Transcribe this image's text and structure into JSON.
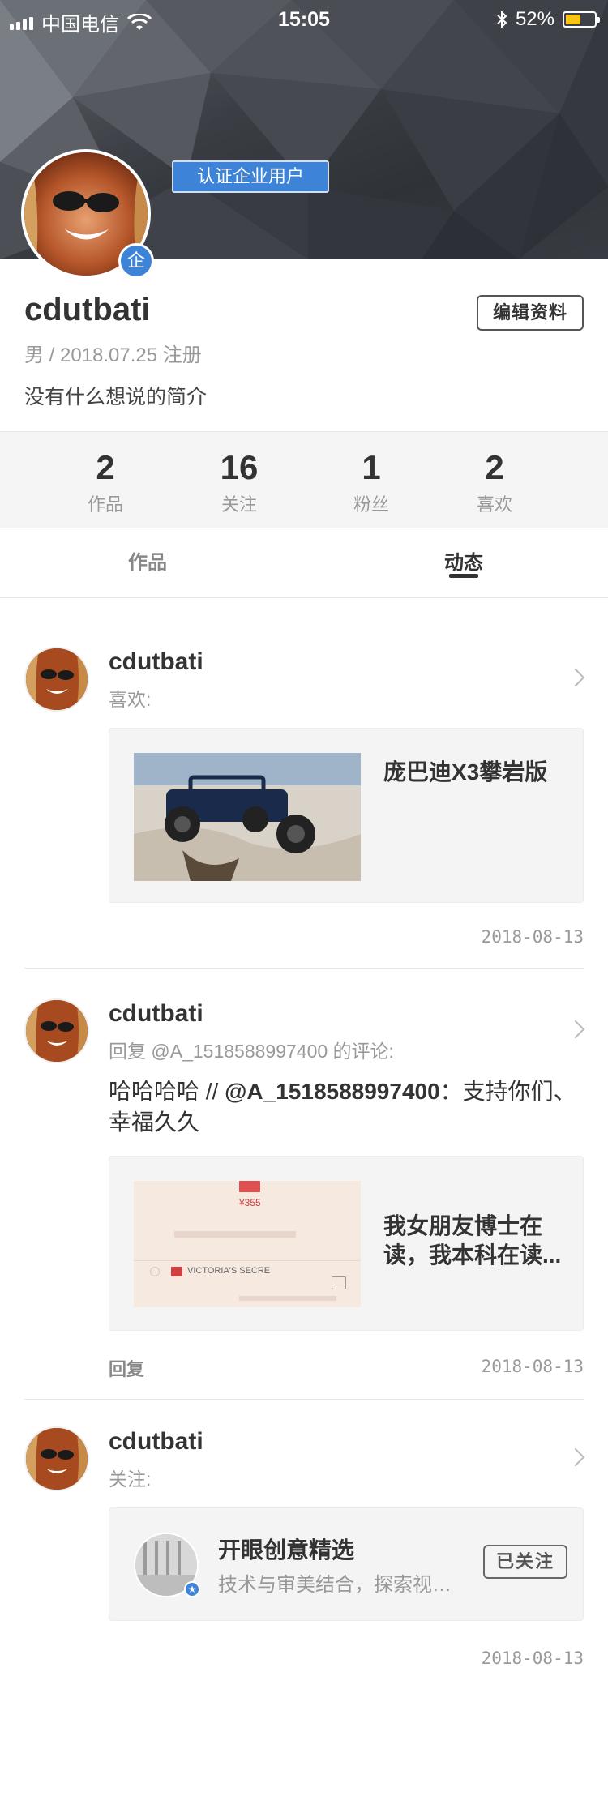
{
  "status_bar": {
    "carrier": "中国电信",
    "time": "15:05",
    "battery_percent": "52%",
    "battery_level": 0.52,
    "icons": [
      "signal-icon",
      "wifi-icon",
      "bluetooth-icon",
      "battery-icon"
    ]
  },
  "profile": {
    "cert_label": "认证企业用户",
    "avatar_badge": "企",
    "username": "cdutbati",
    "edit_button": "编辑资料",
    "meta": "男  /  2018.07.25 注册",
    "bio": "没有什么想说的简介"
  },
  "stats": [
    {
      "value": "2",
      "label": "作品"
    },
    {
      "value": "16",
      "label": "关注"
    },
    {
      "value": "1",
      "label": "粉丝"
    },
    {
      "value": "2",
      "label": "喜欢"
    }
  ],
  "tabs": [
    {
      "label": "作品",
      "active": false
    },
    {
      "label": "动态",
      "active": true
    }
  ],
  "feed": [
    {
      "name": "cdutbati",
      "action": "喜欢:",
      "card_title": "庞巴迪X3攀岩版",
      "date": "2018-08-13"
    },
    {
      "name": "cdutbati",
      "action": "回复 @A_1518588997400 的评论:",
      "comment_prefix": "哈哈哈哈  //  ",
      "comment_mention": "@A_1518588997400",
      "comment_suffix": "：支持你们、幸福久久",
      "card_title": "我女朋友博士在读，我本科在读...",
      "reply_label": "回复",
      "date": "2018-08-13",
      "thumb_texts": [
        "¥355",
        "VICTORIA'S SECRE"
      ]
    },
    {
      "name": "cdutbati",
      "action": "关注:",
      "follow_name": "开眼创意精选",
      "follow_desc": "技术与审美结合，探索视…",
      "follow_button": "已关注",
      "date": "2018-08-13"
    }
  ],
  "colors": {
    "accent_blue": "#3d84d8",
    "battery_yellow": "#f7c614"
  }
}
